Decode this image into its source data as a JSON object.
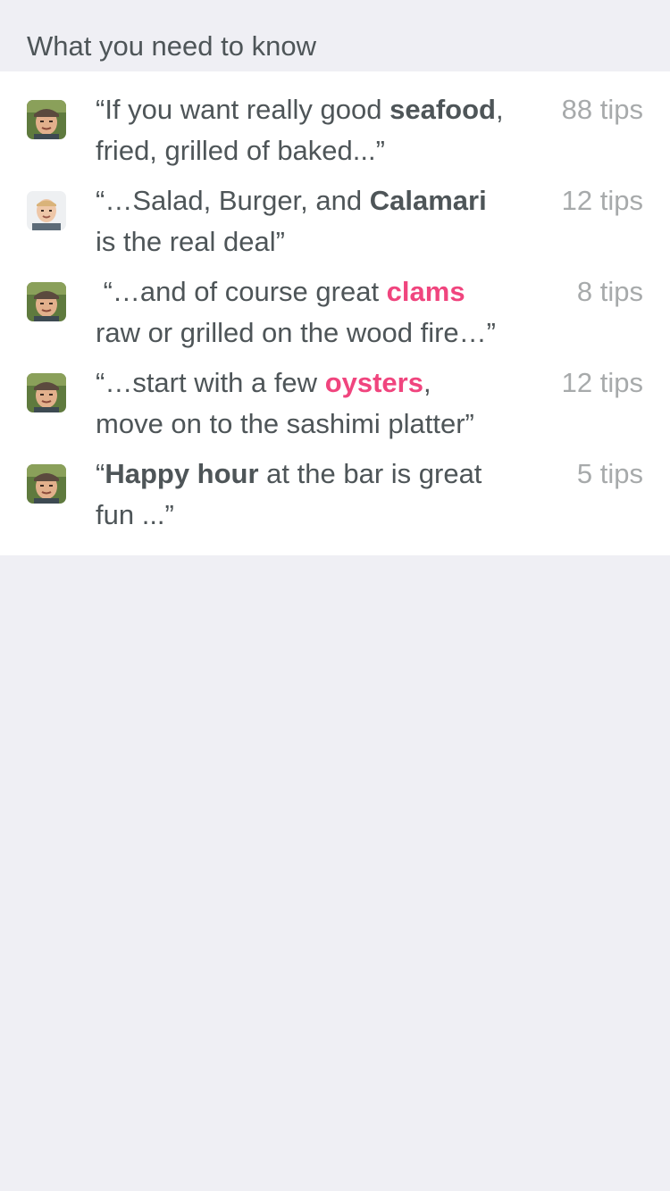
{
  "header": {
    "title": "What you need to know"
  },
  "colors": {
    "highlight_pink": "#f0457e",
    "text": "#4e5558",
    "muted": "#a7aaab",
    "background": "#efeff4"
  },
  "tips": [
    {
      "avatar": "user-avatar-cap",
      "line1": {
        "before": "“If you want really good ",
        "keyword": "seafood",
        "after": ","
      },
      "line2": "fried, grilled of baked...”",
      "keyword_style": "bold",
      "count": "88 tips"
    },
    {
      "avatar": "user-avatar-blond",
      "line1": {
        "before": "“…Salad, Burger, and ",
        "keyword": "Calamari",
        "after": ""
      },
      "line2": "is the real deal”",
      "keyword_style": "bold",
      "count": "12 tips"
    },
    {
      "avatar": "user-avatar-cap",
      "line1": {
        "before": " “…and of course great ",
        "keyword": "clams",
        "after": ""
      },
      "line2": "raw or grilled on the wood fire…”",
      "keyword_style": "pink",
      "count": "8 tips"
    },
    {
      "avatar": "user-avatar-cap",
      "line1": {
        "before": "“…start with a few ",
        "keyword": "oysters",
        "after": ","
      },
      "line2": "move on to the sashimi platter”",
      "keyword_style": "pink",
      "count": "12 tips"
    },
    {
      "avatar": "user-avatar-cap",
      "line1": {
        "before": "“",
        "keyword": "Happy hour",
        "after": " at the bar is great"
      },
      "line2": "fun ...”",
      "keyword_style": "bold",
      "count": "5 tips"
    }
  ]
}
